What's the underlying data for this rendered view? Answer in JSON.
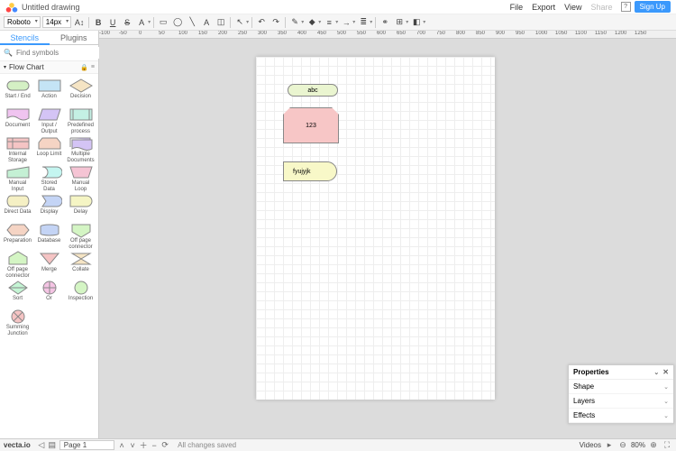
{
  "header": {
    "title": "Untitled drawing",
    "menu": [
      "File",
      "Export",
      "View",
      "Share"
    ],
    "signup": "Sign Up"
  },
  "toolbar": {
    "font": "Roboto",
    "size": "14px"
  },
  "ruler_marks": [
    -100,
    -50,
    0,
    50,
    100,
    150,
    200,
    250,
    300,
    350,
    400,
    450,
    500,
    550,
    600,
    650,
    700,
    750,
    800,
    850,
    900,
    950,
    1000,
    1050,
    1100,
    1150,
    1200,
    1250
  ],
  "sidebar": {
    "tabs": [
      "Stencils",
      "Plugins"
    ],
    "search_placeholder": "Find symbols",
    "category": "Flow Chart",
    "shapes": [
      [
        "Start / End",
        "Action",
        "Decision"
      ],
      [
        "Document",
        "Input / Output",
        "Predefined process"
      ],
      [
        "Internal Storage",
        "Loop Limit",
        "Multiple Documents"
      ],
      [
        "Manual Input",
        "Stored Data",
        "Manual Loop"
      ],
      [
        "Direct Data",
        "Display",
        "Delay"
      ],
      [
        "Preparation",
        "Database",
        "Off page connector"
      ],
      [
        "Off page connector",
        "Merge",
        "Collate"
      ],
      [
        "Sort",
        "Or",
        "Inspection"
      ],
      [
        "Summing Junction",
        "",
        ""
      ]
    ],
    "shape_colors": [
      [
        "#d4f0c4",
        "#c4e4f5",
        "#f5e4c4"
      ],
      [
        "#f0c4f0",
        "#d4c4f5",
        "#c4f0e4"
      ],
      [
        "#f5c4c4",
        "#f5d4c4",
        "#d4c4f5"
      ],
      [
        "#c4f0d4",
        "#c4f5f0",
        "#f5c4d4"
      ],
      [
        "#f5f0c4",
        "#c4d4f5",
        "#f5f5c4"
      ],
      [
        "#f5d4c4",
        "#c4d4f5",
        "#d4f5c4"
      ],
      [
        "#d4f5c4",
        "#f5c4c4",
        "#f5e4c4"
      ],
      [
        "#c4f5d4",
        "#f5c4e4",
        "#d4f5c4"
      ],
      [
        "#f5c4c4",
        "",
        ""
      ]
    ]
  },
  "canvas": {
    "shapes": {
      "terminator": "abc",
      "action": "123",
      "delay": "fyujyjk"
    }
  },
  "properties": {
    "title": "Properties",
    "sections": [
      "Shape",
      "Layers",
      "Effects"
    ]
  },
  "status": {
    "brand": "vecta.io",
    "page": "Page 1",
    "saved": "All changes saved",
    "videos": "Videos",
    "zoom": "80%"
  }
}
